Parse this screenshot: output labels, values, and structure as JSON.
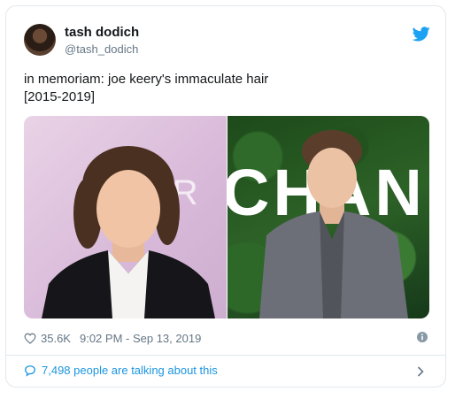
{
  "tweet": {
    "author_name": "tash dodich",
    "author_handle": "@tash_dodich",
    "text_line1": "in memoriam: joe keery's immaculate hair",
    "text_line2": "[2015-2019]",
    "likes": "35.6K",
    "timestamp": "9:02 PM - Sep 13, 2019",
    "talking": "7,498 people are talking about this"
  },
  "photos": {
    "left_sign_text": "K R A",
    "right_sign_text": "CHAN"
  },
  "icons": {
    "brand": "twitter-bird-icon",
    "like": "heart-icon",
    "info": "info-icon",
    "reply": "speech-bubble-icon",
    "more": "chevron-right-icon"
  },
  "colors": {
    "accent": "#1da1f2",
    "link": "#1b95e0",
    "muted": "#657786",
    "border": "#e1e8ed"
  }
}
